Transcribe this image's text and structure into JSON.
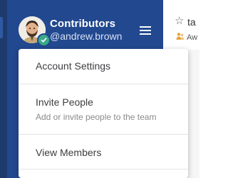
{
  "team": {
    "name": "Contributors",
    "username": "@andrew.brown"
  },
  "channel": {
    "name": "ta",
    "subtitle": "Aw"
  },
  "menu": {
    "items": [
      {
        "label": "Account Settings"
      },
      {
        "label": "Invite People",
        "description": "Add or invite people to the team"
      },
      {
        "label": "View Members"
      }
    ]
  },
  "icons": {
    "menu": "hamburger-icon",
    "status": "online-check-icon",
    "favorite": "star-outline-icon",
    "members": "people-icon"
  },
  "colors": {
    "sidebar": "#22488f",
    "strip": "#1e3a6c",
    "status": "#3aa98b"
  }
}
